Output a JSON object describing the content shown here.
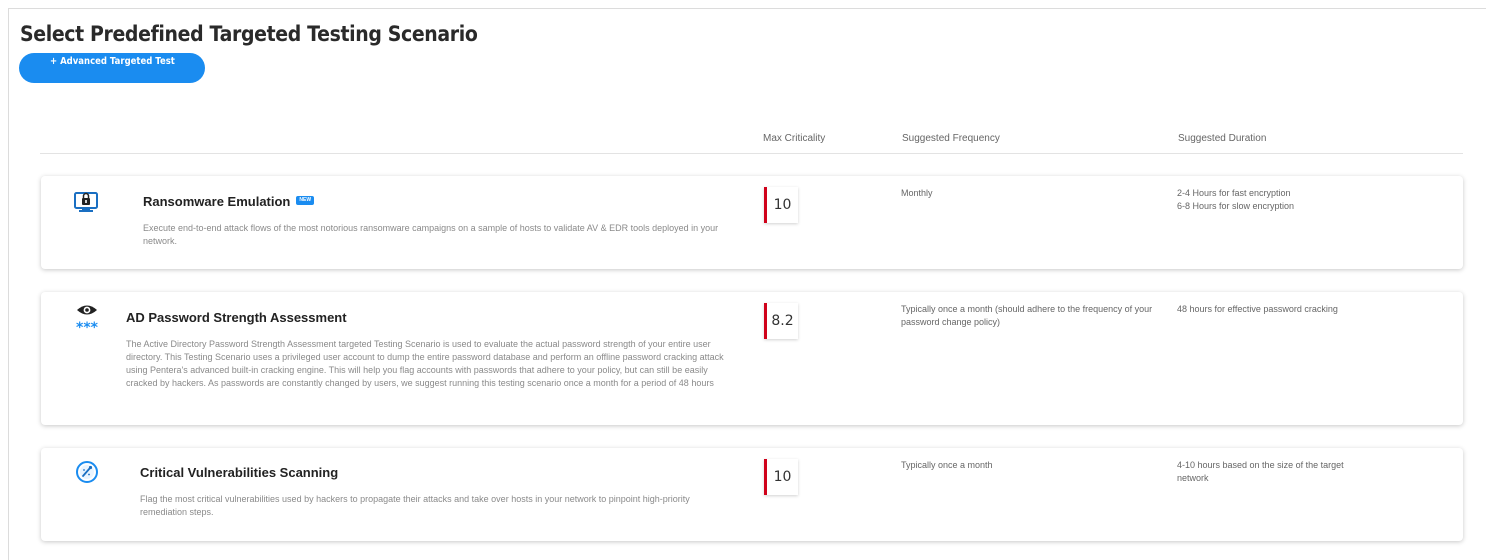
{
  "page": {
    "title": "Select Predefined Targeted Testing Scenario"
  },
  "toolbar": {
    "advanced_test_label": "+ Advanced Targeted Test"
  },
  "columns": {
    "criticality": "Max Criticality",
    "frequency": "Suggested Frequency",
    "duration": "Suggested Duration"
  },
  "scenarios": [
    {
      "title": "Ransomware Emulation",
      "badge": "NEW",
      "icon": "ransomware-monitor-lock-icon",
      "description": "Execute end-to-end attack flows of the most notorious ransomware campaigns on a sample of hosts to validate AV & EDR tools deployed in your network.",
      "criticality": "10",
      "frequency": "Monthly",
      "duration_lines": [
        "2-4 Hours for fast encryption",
        "6-8 Hours for slow encryption"
      ]
    },
    {
      "title": "AD Password Strength Assessment",
      "icon": "eye-password-icon",
      "description": "The Active Directory Password Strength Assessment targeted Testing Scenario is used to evaluate the actual password strength of your entire user directory. This Testing Scenario uses a privileged user account to dump the entire password database and perform an offline password cracking attack using Pentera's advanced built-in cracking engine. This will help you flag accounts with passwords that adhere to your policy, but can still be easily cracked by hackers. As passwords are constantly changed by users, we suggest running this testing scenario once a month for a period of 48 hours",
      "criticality": "8.2",
      "frequency": "Typically once a month (should adhere to the frequency of your password change policy)",
      "duration": "48 hours for effective password cracking"
    },
    {
      "title": "Critical Vulnerabilities Scanning",
      "icon": "vulnerability-scan-icon",
      "description": "Flag the most critical vulnerabilities used by hackers to propagate their attacks and take over hosts in your network to pinpoint high-priority remediation steps.",
      "criticality": "10",
      "frequency": "Typically once a month",
      "duration": "4-10 hours based on the size of the target network"
    }
  ],
  "colors": {
    "accent": "#1a8cf0",
    "criticality_bar": "#d0021b"
  }
}
